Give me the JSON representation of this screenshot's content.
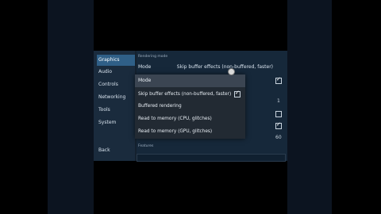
{
  "sidebar": {
    "items": [
      {
        "label": "Graphics"
      },
      {
        "label": "Audio"
      },
      {
        "label": "Controls"
      },
      {
        "label": "Networking"
      },
      {
        "label": "Tools"
      },
      {
        "label": "System"
      }
    ],
    "back_label": "Back"
  },
  "panel": {
    "section_rendering": "Rendering mode",
    "mode_label": "Mode",
    "mode_value": "Skip buffer effects (non-buffered, faster)",
    "value_1": "1",
    "value_60": "60",
    "section_features": "Features"
  },
  "dropdown": {
    "title": "Mode",
    "options": [
      {
        "label": "Skip buffer effects (non-buffered, faster)",
        "checked": true
      },
      {
        "label": "Buffered rendering",
        "checked": false
      },
      {
        "label": "Read to memory (CPU, glitches)",
        "checked": false
      },
      {
        "label": "Read to memory (GPU, glitches)",
        "checked": false
      }
    ]
  },
  "colors": {
    "accent": "#2f5f87",
    "panel": "#16283a",
    "dropdown": "#222a33"
  }
}
